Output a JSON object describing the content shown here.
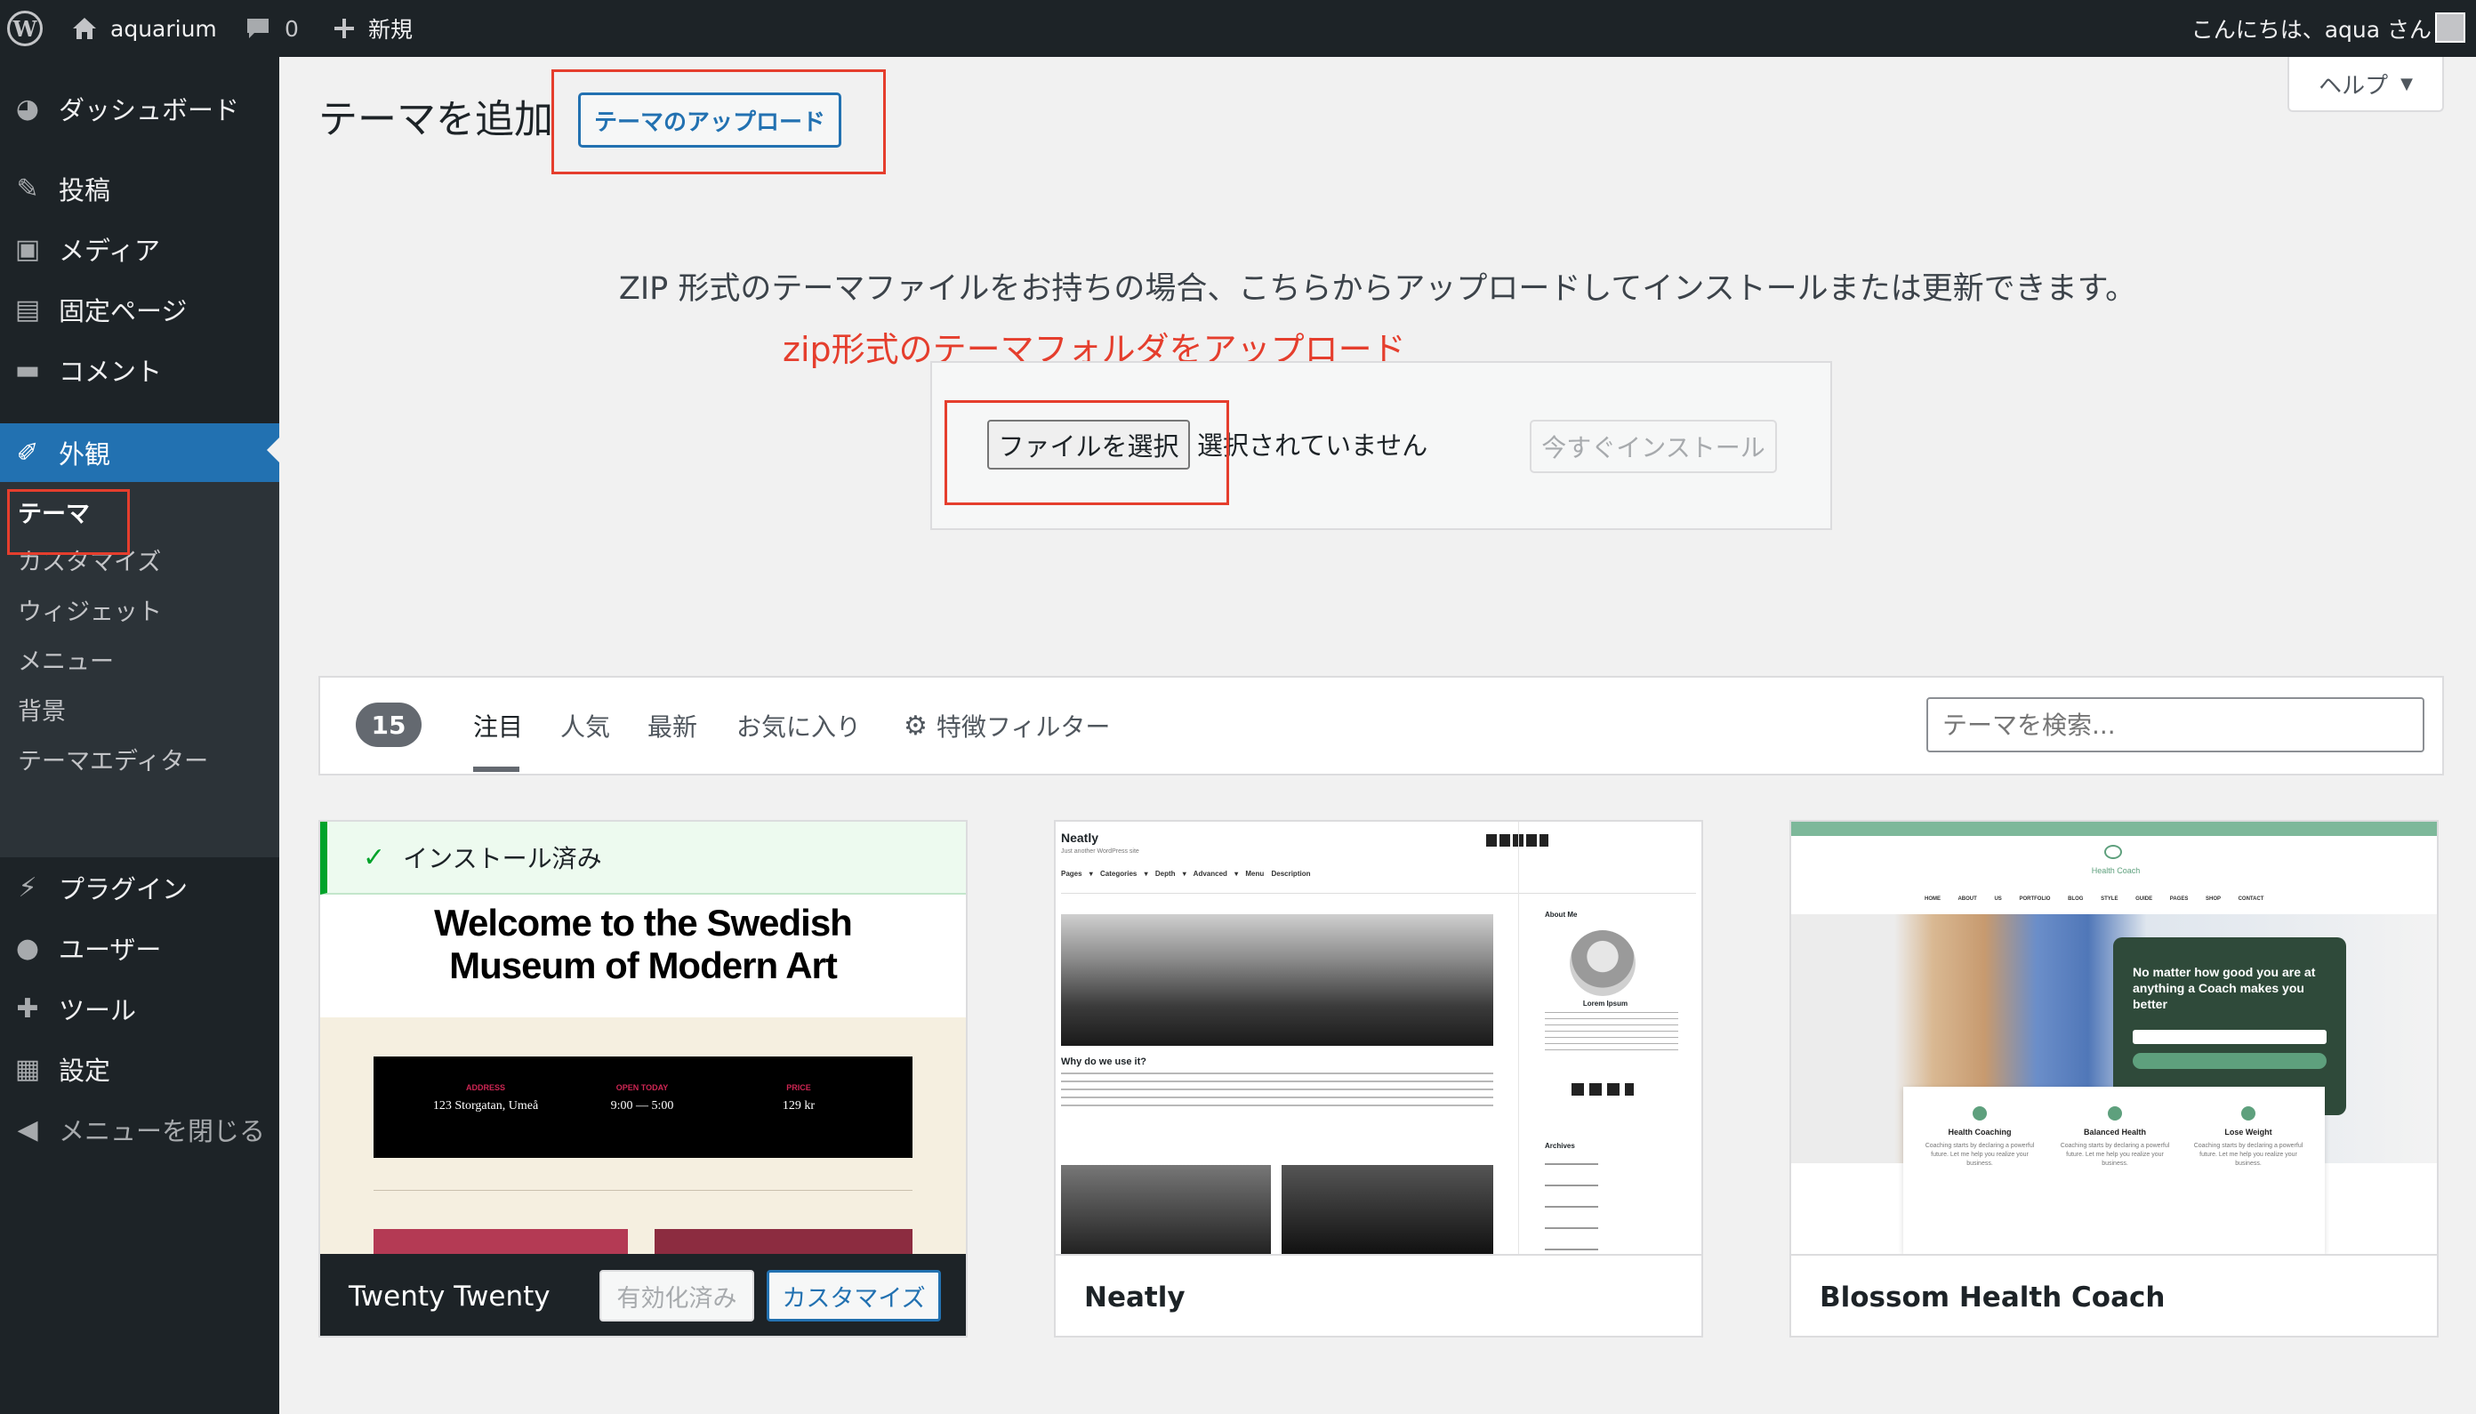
{
  "adminbar": {
    "site_name": "aquarium",
    "comments_count": "0",
    "new_label": "新規",
    "greeting": "こんにちは、aqua さん"
  },
  "sidebar": {
    "items": [
      {
        "label": "ダッシュボード",
        "icon": "dashboard-icon"
      },
      {
        "label": "投稿",
        "icon": "pin-icon"
      },
      {
        "label": "メディア",
        "icon": "media-icon"
      },
      {
        "label": "固定ページ",
        "icon": "page-icon"
      },
      {
        "label": "コメント",
        "icon": "comment-icon"
      },
      {
        "label": "外観",
        "icon": "appearance-icon"
      },
      {
        "label": "プラグイン",
        "icon": "plugin-icon"
      },
      {
        "label": "ユーザー",
        "icon": "user-icon"
      },
      {
        "label": "ツール",
        "icon": "wrench-icon"
      },
      {
        "label": "設定",
        "icon": "settings-icon"
      }
    ],
    "submenu": [
      "テーマ",
      "カスタマイズ",
      "ウィジェット",
      "メニュー",
      "背景",
      "テーマエディター"
    ],
    "collapse_label": "メニューを閉じる"
  },
  "header": {
    "title": "テーマを追加",
    "upload_button": "テーマのアップロード",
    "help_label": "ヘルプ"
  },
  "upload": {
    "description": "ZIP 形式のテーマファイルをお持ちの場合、こちらからアップロードしてインストールまたは更新できます。",
    "annotation": "zip形式のテーマフォルダをアップロード",
    "choose_file": "ファイルを選択",
    "no_file": "選択されていません",
    "install_now": "今すぐインストール"
  },
  "filter": {
    "count": "15",
    "tabs": [
      "注目",
      "人気",
      "最新",
      "お気に入り"
    ],
    "feature_filter": "特徴フィルター",
    "search_placeholder": "テーマを検索..."
  },
  "themes": [
    {
      "name": "Twenty Twenty",
      "installed_label": "インストール済み",
      "activated_label": "有効化済み",
      "customize_label": "カスタマイズ",
      "preview": {
        "headline": "Welcome to the Swedish Museum of Modern Art",
        "address_label": "ADDRESS",
        "address": "123 Storgatan, Umeå",
        "open_label": "OPEN TODAY",
        "open": "9:00 — 5:00",
        "price_label": "PRICE",
        "price": "129 kr"
      }
    },
    {
      "name": "Neatly",
      "preview": {
        "brand": "Neatly",
        "tagline": "Just another WordPress site",
        "nav": "Pages ▾ Categories ▾ Depth ▾ Advanced ▾ Menu Description",
        "post_title": "Why do we use it?",
        "about": "About Me",
        "author": "Lorem Ipsum",
        "archives": "Archives"
      }
    },
    {
      "name": "Blossom Health Coach",
      "preview": {
        "logo": "Health Coach",
        "nav": "HOME ABOUT US PORTFOLIO BLOG STYLE GUIDE PAGES SHOP CONTACT",
        "hero_text": "No matter how good you are at anything a Coach makes you better",
        "features": [
          "Health Coaching",
          "Balanced Health",
          "Lose Weight"
        ],
        "feature_text": "Coaching starts by declaring a powerful future. Let me help you realize your business."
      }
    }
  ]
}
